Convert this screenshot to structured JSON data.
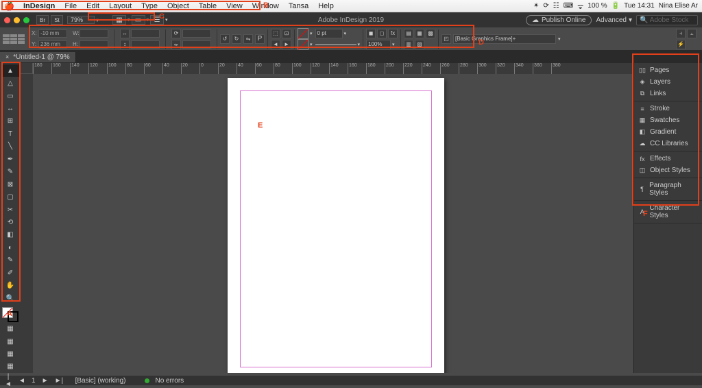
{
  "mac_menubar": {
    "items": [
      "InDesign",
      "File",
      "Edit",
      "Layout",
      "Type",
      "Object",
      "Table",
      "View",
      "Window",
      "Tansa",
      "Help"
    ],
    "status": {
      "battery": "100 %",
      "battery_icon": "⚡",
      "time": "Tue 14:31",
      "user": "Nina Elise Ar",
      "icons": [
        "✴",
        "⟳",
        "☷",
        "⌨",
        "ᯤ"
      ]
    }
  },
  "app": {
    "title": "Adobe InDesign 2019",
    "publish": "Publish Online",
    "workspace": "Advanced",
    "search_placeholder": "Adobe Stock",
    "zoom": "79%"
  },
  "control_panel": {
    "x": "-10 mm",
    "y": "236 mm",
    "w": "",
    "h": "",
    "stroke_weight": "0 pt",
    "opacity": "100%",
    "graphics_frame": "[Basic Graphics Frame]+"
  },
  "document": {
    "tab_name": "*Untitled-1 @ 79%"
  },
  "ruler_ticks": [
    "180",
    "160",
    "140",
    "120",
    "100",
    "80",
    "60",
    "40",
    "20",
    "0",
    "20",
    "40",
    "60",
    "80",
    "100",
    "120",
    "140",
    "160",
    "180",
    "200",
    "220",
    "240",
    "260",
    "280",
    "300",
    "320",
    "340",
    "360",
    "380"
  ],
  "tools": [
    {
      "name": "selection-tool",
      "glyph": "▲"
    },
    {
      "name": "direct-selection-tool",
      "glyph": "△"
    },
    {
      "name": "page-tool",
      "glyph": "▭"
    },
    {
      "name": "gap-tool",
      "glyph": "↔"
    },
    {
      "name": "content-collector-tool",
      "glyph": "⊞"
    },
    {
      "name": "type-tool",
      "glyph": "T"
    },
    {
      "name": "line-tool",
      "glyph": "╲"
    },
    {
      "name": "pen-tool",
      "glyph": "✒"
    },
    {
      "name": "pencil-tool",
      "glyph": "✎"
    },
    {
      "name": "rectangle-frame-tool",
      "glyph": "⊠"
    },
    {
      "name": "rectangle-tool",
      "glyph": "▢"
    },
    {
      "name": "scissors-tool",
      "glyph": "✂"
    },
    {
      "name": "free-transform-tool",
      "glyph": "⟲"
    },
    {
      "name": "gradient-swatch-tool",
      "glyph": "◧"
    },
    {
      "name": "gradient-feather-tool",
      "glyph": "◐"
    },
    {
      "name": "note-tool",
      "glyph": "✎"
    },
    {
      "name": "eyedropper-tool",
      "glyph": "✐"
    },
    {
      "name": "hand-tool",
      "glyph": "✋"
    },
    {
      "name": "zoom-tool",
      "glyph": "🔍"
    }
  ],
  "panels": [
    {
      "group": [
        {
          "name": "Pages",
          "icon": "pages"
        },
        {
          "name": "Layers",
          "icon": "layers"
        },
        {
          "name": "Links",
          "icon": "links"
        }
      ]
    },
    {
      "group": [
        {
          "name": "Stroke",
          "icon": "stroke"
        },
        {
          "name": "Swatches",
          "icon": "swatches"
        },
        {
          "name": "Gradient",
          "icon": "gradient"
        },
        {
          "name": "CC Libraries",
          "icon": "cc"
        }
      ]
    },
    {
      "group": [
        {
          "name": "Effects",
          "icon": "fx"
        },
        {
          "name": "Object Styles",
          "icon": "obj"
        }
      ]
    },
    {
      "group": [
        {
          "name": "Paragraph Styles",
          "icon": "para"
        }
      ]
    },
    {
      "group": [
        {
          "name": "Character Styles",
          "icon": "char"
        }
      ]
    }
  ],
  "status_bar": {
    "page": "1",
    "preset": "[Basic] (working)",
    "errors": "No errors"
  },
  "annotations": {
    "A": "A",
    "B": "B",
    "C": "C",
    "D": "D",
    "E": "E",
    "F": "F"
  }
}
